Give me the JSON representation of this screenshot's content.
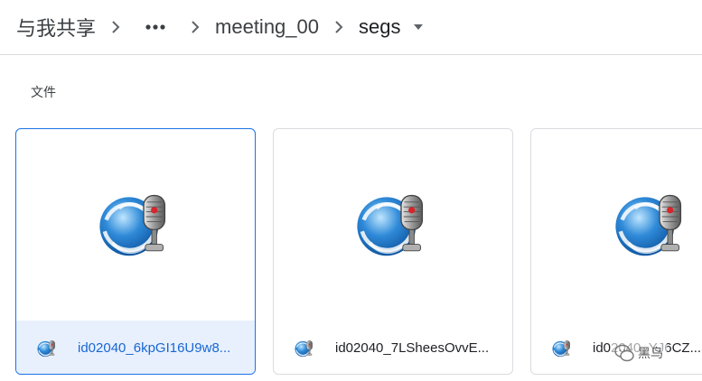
{
  "breadcrumb": {
    "root": "与我共享",
    "more": "•••",
    "folder1": "meeting_00",
    "current": "segs"
  },
  "section": {
    "title": "文件"
  },
  "files": [
    {
      "name": "id02040_6kpGI16U9w8..."
    },
    {
      "name": "id02040_7LSheesOvvE..."
    },
    {
      "name": "id02040_YJ6CZ..."
    }
  ],
  "watermark": {
    "text": "黑鸟"
  },
  "colors": {
    "accent": "#1a73e8",
    "selected_bg": "#e8f0fe",
    "border": "#dadce0"
  }
}
